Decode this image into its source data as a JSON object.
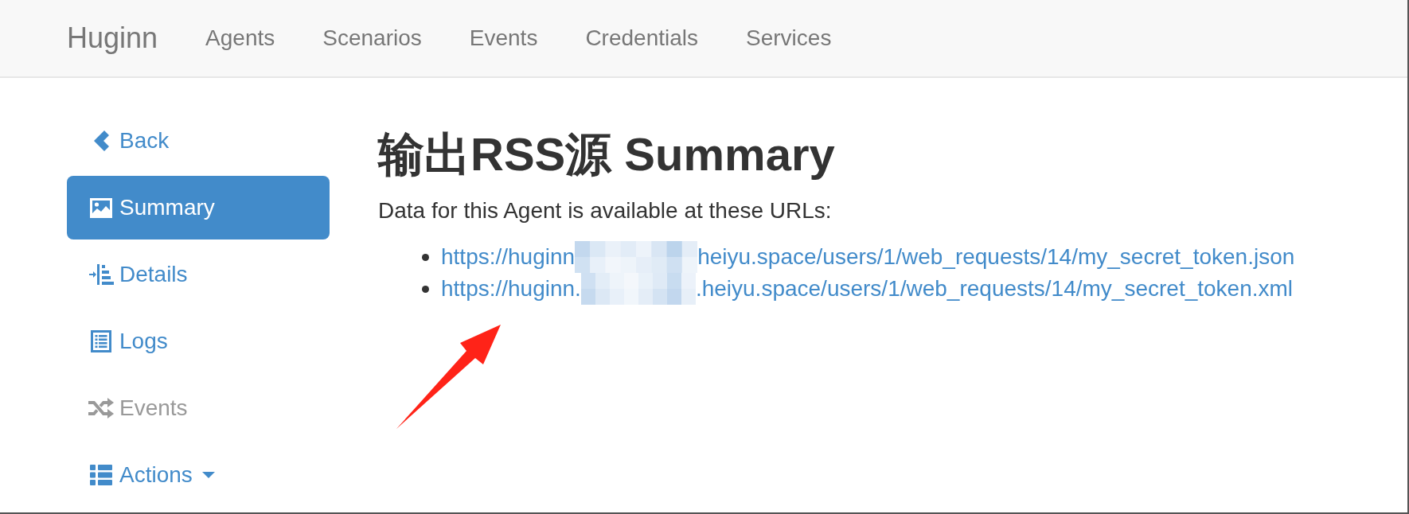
{
  "navbar": {
    "brand": "Huginn",
    "links": [
      "Agents",
      "Scenarios",
      "Events",
      "Credentials",
      "Services"
    ]
  },
  "sidebar": {
    "items": [
      {
        "kind": "back",
        "label": "Back",
        "selected": false,
        "disabled": false
      },
      {
        "kind": "summary",
        "label": "Summary",
        "selected": true,
        "disabled": false
      },
      {
        "kind": "details",
        "label": "Details",
        "selected": false,
        "disabled": false
      },
      {
        "kind": "logs",
        "label": "Logs",
        "selected": false,
        "disabled": false
      },
      {
        "kind": "events",
        "label": "Events",
        "selected": false,
        "disabled": true
      },
      {
        "kind": "actions",
        "label": "Actions",
        "selected": false,
        "disabled": false
      }
    ]
  },
  "main": {
    "title": "输出RSS源 Summary",
    "intro": "Data for this Agent is available at these URLs:",
    "urls": [
      {
        "prefix": "https://huginn",
        "suffix": "heiyu.space/users/1/web_requests/14/my_secret_token.json"
      },
      {
        "prefix": "https://huginn.",
        "suffix": ".heiyu.space/users/1/web_requests/14/my_secret_token.xml"
      }
    ]
  }
}
